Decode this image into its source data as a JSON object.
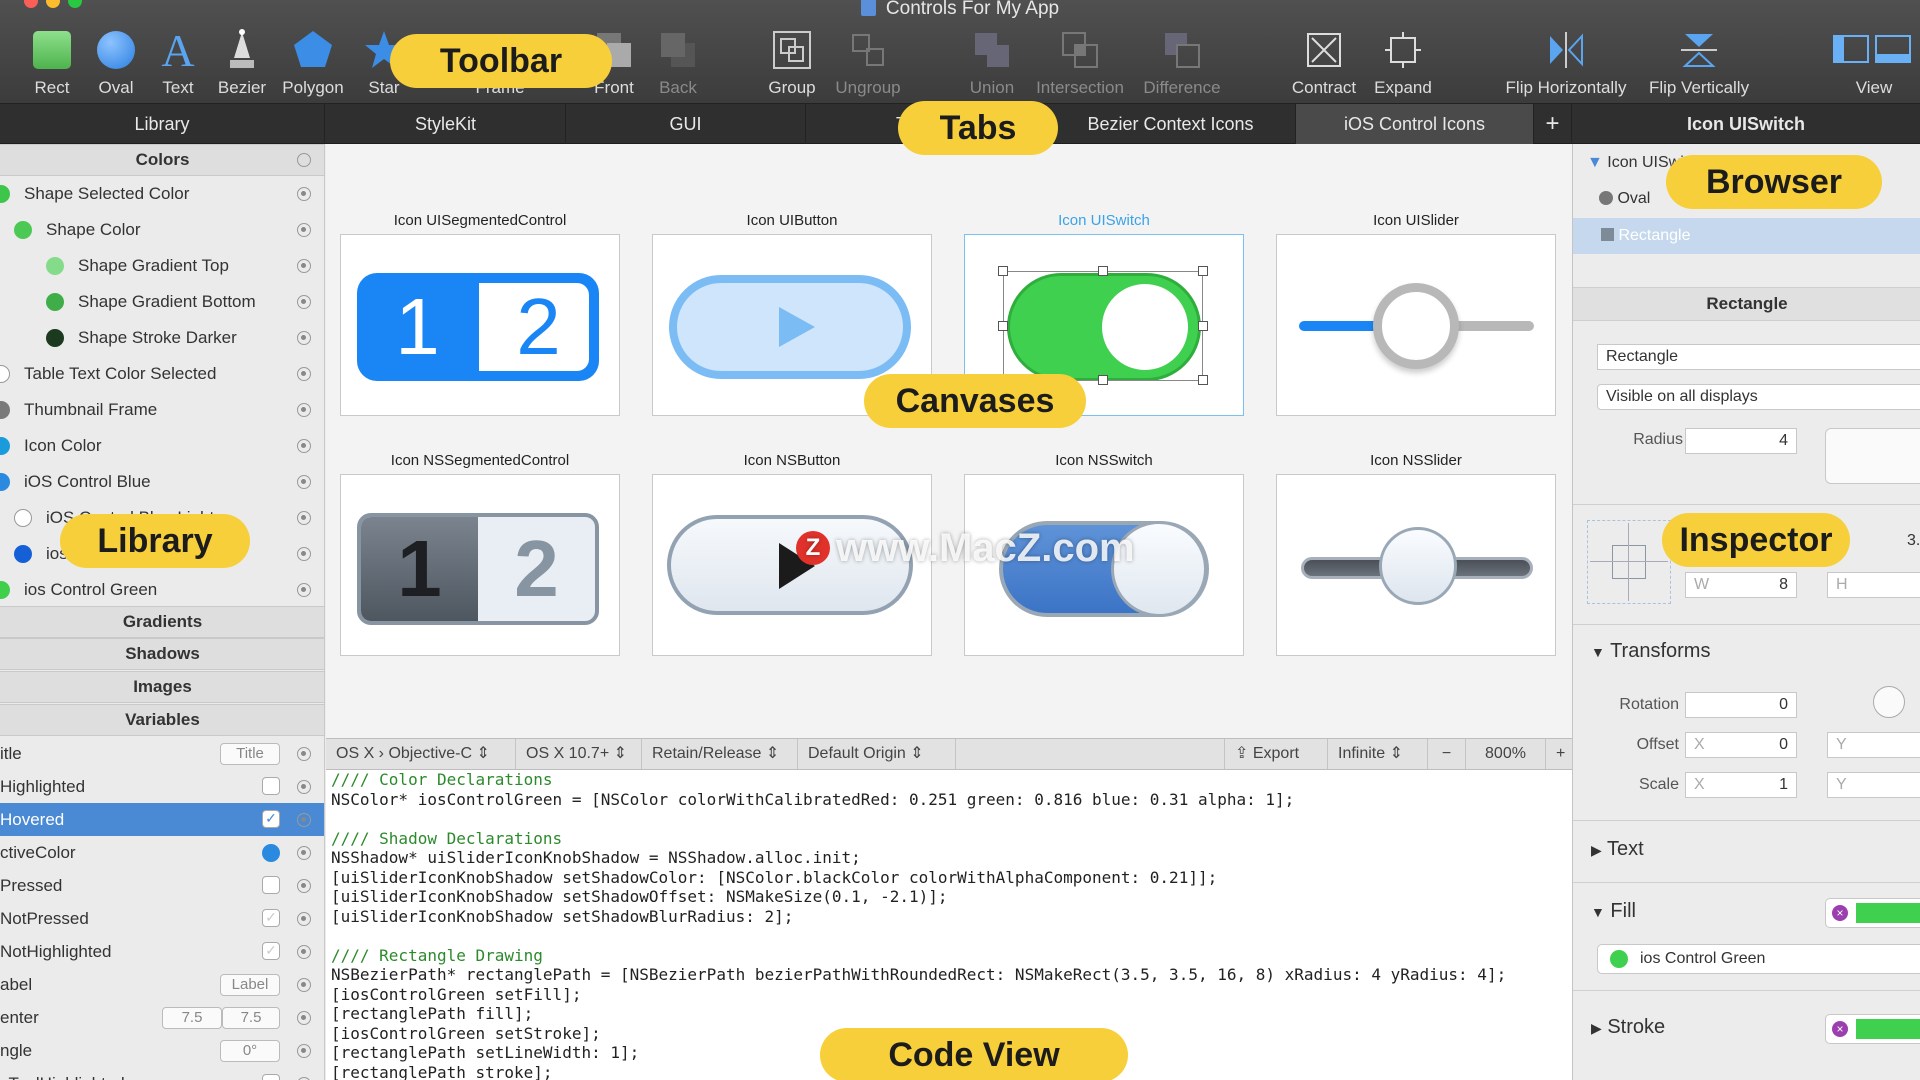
{
  "window": {
    "title": "Controls For My App"
  },
  "toolbar": {
    "items": [
      {
        "label": "Rect",
        "icon": "rect-icon"
      },
      {
        "label": "Oval",
        "icon": "oval-icon"
      },
      {
        "label": "Text",
        "icon": "text-icon"
      },
      {
        "label": "Bezier",
        "icon": "bezier-icon"
      },
      {
        "label": "Polygon",
        "icon": "polygon-icon"
      },
      {
        "label": "Star",
        "icon": "star-icon"
      },
      {
        "label": "Frame",
        "icon": "frame-icon"
      },
      {
        "label": "Front",
        "icon": "front-icon"
      },
      {
        "label": "Back",
        "icon": "back-icon"
      },
      {
        "label": "Group",
        "icon": "group-icon"
      },
      {
        "label": "Ungroup",
        "icon": "ungroup-icon"
      },
      {
        "label": "Union",
        "icon": "union-icon"
      },
      {
        "label": "Intersection",
        "icon": "intersection-icon"
      },
      {
        "label": "Difference",
        "icon": "difference-icon"
      },
      {
        "label": "Contract",
        "icon": "contract-icon"
      },
      {
        "label": "Expand",
        "icon": "expand-icon"
      },
      {
        "label": "Flip Horizontally",
        "icon": "flip-horizontal-icon"
      },
      {
        "label": "Flip Vertically",
        "icon": "flip-vertical-icon"
      },
      {
        "label": "View",
        "icon": "view-icon"
      }
    ]
  },
  "tabs": {
    "library": "Library",
    "items": [
      "StyleKit",
      "GUI",
      "Toolbar",
      "Bezier Context Icons",
      "iOS Control Icons"
    ],
    "add": "+",
    "browser_title": "Icon UISwitch"
  },
  "library": {
    "sections": {
      "colors": "Colors",
      "gradients": "Gradients",
      "shadows": "Shadows",
      "images": "Images",
      "variables": "Variables"
    },
    "colors": [
      {
        "name": "Shape Selected Color",
        "color": "#3ec64a"
      },
      {
        "name": "Shape Color",
        "color": "#4cc955"
      },
      {
        "name": "Shape Gradient Top",
        "color": "#84dc8a"
      },
      {
        "name": "Shape Gradient Bottom",
        "color": "#3fae48"
      },
      {
        "name": "Shape Stroke Darker",
        "color": "#1c3a1f"
      },
      {
        "name": "Table Text Color Selected",
        "color": "#ffffff"
      },
      {
        "name": "Thumbnail Frame",
        "color": "#7a7a7a"
      },
      {
        "name": "Icon Color",
        "color": "#1a9bdb"
      },
      {
        "name": "iOS Control Blue",
        "color": "#2a8ae0"
      },
      {
        "name": "iOS Control Blue Light",
        "color": "#ffffff"
      },
      {
        "name": "ios Control Blue Darker",
        "color": "#1560d6"
      },
      {
        "name": "ios Control Green",
        "color": "#3fcf4a"
      }
    ],
    "variables": [
      {
        "name": "itle",
        "value": "Title"
      },
      {
        "name": "Highlighted"
      },
      {
        "name": "Hovered"
      },
      {
        "name": "ctiveColor"
      },
      {
        "name": "Pressed"
      },
      {
        "name": "NotPressed"
      },
      {
        "name": "NotHighlighted"
      },
      {
        "name": "abel",
        "value": "Label"
      },
      {
        "name": "enter",
        "x": "7.5",
        "y": "7.5"
      },
      {
        "name": "ngle",
        "value": "0°"
      },
      {
        "name": "sToolHighlighted"
      }
    ]
  },
  "canvases": [
    {
      "label": "Icon UISegmentedControl",
      "seg1": "1",
      "seg2": "2"
    },
    {
      "label": "Icon UIButton"
    },
    {
      "label": "Icon UISwitch"
    },
    {
      "label": "Icon UISlider"
    },
    {
      "label": "Icon NSSegmentedControl",
      "seg1": "1",
      "seg2": "2"
    },
    {
      "label": "Icon NSButton"
    },
    {
      "label": "Icon NSSwitch"
    },
    {
      "label": "Icon NSSlider"
    }
  ],
  "watermark": "www.MacZ.com",
  "code_bar": {
    "platform": "OS X",
    "language": "Objective-C",
    "target": "OS X 10.7+",
    "memory": "Retain/Release",
    "origin": "Default Origin",
    "export": "Export",
    "export_mode": "Infinite",
    "zoom_out": "−",
    "zoom": "800%",
    "zoom_in": "+"
  },
  "code": {
    "lines": [
      "//// Color Declarations",
      "NSColor* iosControlGreen = [NSColor colorWithCalibratedRed: 0.251 green: 0.816 blue: 0.31 alpha: 1];",
      "",
      "//// Shadow Declarations",
      "NSShadow* uiSliderIconKnobShadow = NSShadow.alloc.init;",
      "[uiSliderIconKnobShadow setShadowColor: [NSColor.blackColor colorWithAlphaComponent: 0.21]];",
      "[uiSliderIconKnobShadow setShadowOffset: NSMakeSize(0.1, -2.1)];",
      "[uiSliderIconKnobShadow setShadowBlurRadius: 2];",
      "",
      "//// Rectangle Drawing",
      "NSBezierPath* rectanglePath = [NSBezierPath bezierPathWithRoundedRect: NSMakeRect(3.5, 3.5, 16, 8) xRadius: 4 yRadius: 4];",
      "[iosControlGreen setFill];",
      "[rectanglePath fill];",
      "[iosControlGreen setStroke];",
      "[rectanglePath setLineWidth: 1];",
      "[rectanglePath stroke];"
    ]
  },
  "browser": {
    "items": [
      "Icon UISwitch",
      "Oval",
      "Rectangle"
    ]
  },
  "inspector": {
    "title": "Rectangle",
    "name": "Rectangle",
    "visibility": "Visible on all displays",
    "radius_label": "Radius",
    "radius": "4",
    "w_label": "W",
    "w": "8",
    "h_label": "H",
    "extra": "3.",
    "transforms": "Transforms",
    "rotation_label": "Rotation",
    "rotation": "0",
    "offset_label": "Offset",
    "offset_x_label": "X",
    "offset_x": "0",
    "offset_y_label": "Y",
    "scale_label": "Scale",
    "scale_x_label": "X",
    "scale_x": "1",
    "scale_y_label": "Y",
    "text": "Text",
    "fill": "Fill",
    "fill_color": "ios Control Green",
    "stroke": "Stroke"
  },
  "callouts": {
    "toolbar": "Toolbar",
    "tabs": "Tabs",
    "canvases": "Canvases",
    "library": "Library",
    "browser": "Browser",
    "inspector": "Inspector",
    "code_view": "Code View"
  },
  "colors": {
    "accent_blue": "#1a86f5",
    "ios_green": "#40d04f",
    "callout": "#f7cf3a",
    "selection": "#4a89d4"
  }
}
